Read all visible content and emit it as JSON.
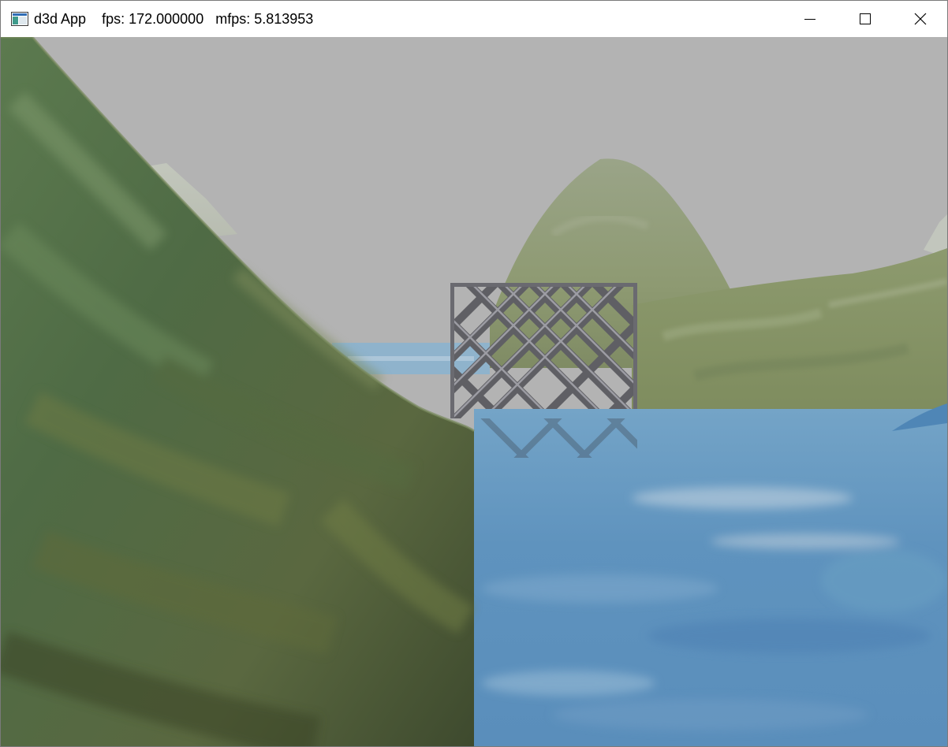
{
  "window": {
    "app_title": "d3d App",
    "fps_label": "fps: 172.000000",
    "mfps_label": "mfps: 5.813953",
    "icon": "app-window-icon"
  },
  "caption_buttons": {
    "minimize_icon": "minimize-icon",
    "maximize_icon": "maximize-icon",
    "close_icon": "close-icon"
  },
  "scene": {
    "sky_color": "#b3b3b3",
    "water_color": "#5f93be",
    "terrain_color": "#5f7a4d",
    "far_hill_color": "#8d9a74",
    "grate_color": "#5f5f64"
  }
}
